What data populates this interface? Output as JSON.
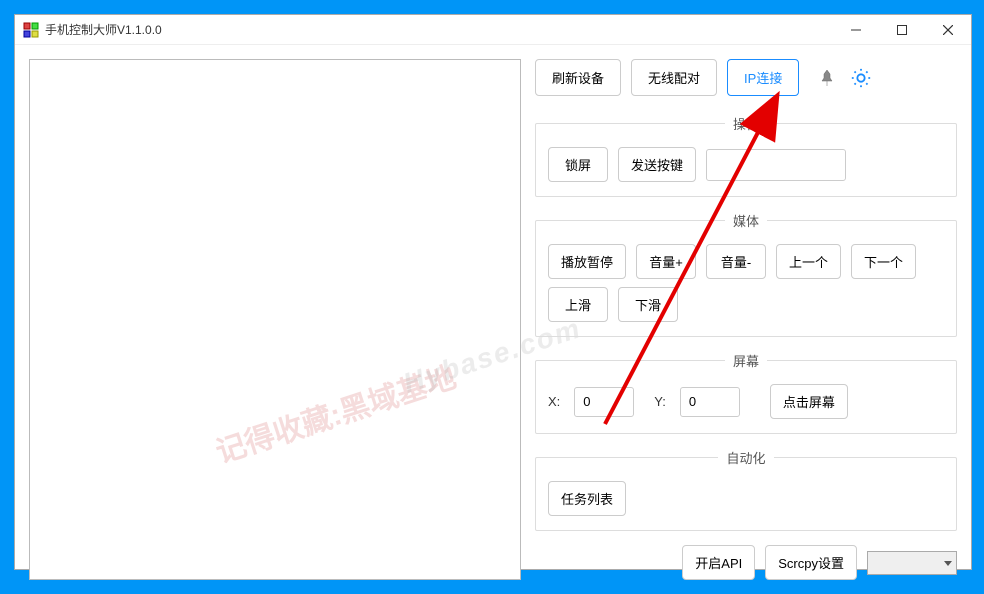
{
  "title": "手机控制大师V1.1.0.0",
  "toprow": {
    "refresh": "刷新设备",
    "wireless": "无线配对",
    "ipconnect": "IP连接"
  },
  "ops": {
    "legend": "操作",
    "lock": "锁屏",
    "sendkey": "发送按键",
    "textbox_value": ""
  },
  "media": {
    "legend": "媒体",
    "playpause": "播放暂停",
    "volup": "音量+",
    "voldown": "音量-",
    "prev": "上一个",
    "next": "下一个",
    "swipeup": "上滑",
    "swipedown": "下滑"
  },
  "screen": {
    "legend": "屏幕",
    "xlabel": "X:",
    "ylabel": "Y:",
    "xval": "0",
    "yval": "0",
    "tap": "点击屏幕"
  },
  "auto": {
    "legend": "自动化",
    "tasks": "任务列表"
  },
  "bottom": {
    "openapi": "开启API",
    "scrcpy": "Scrcpy设置"
  },
  "watermark1": "记得收藏:黑域基地",
  "watermark2": "Hybase.com"
}
